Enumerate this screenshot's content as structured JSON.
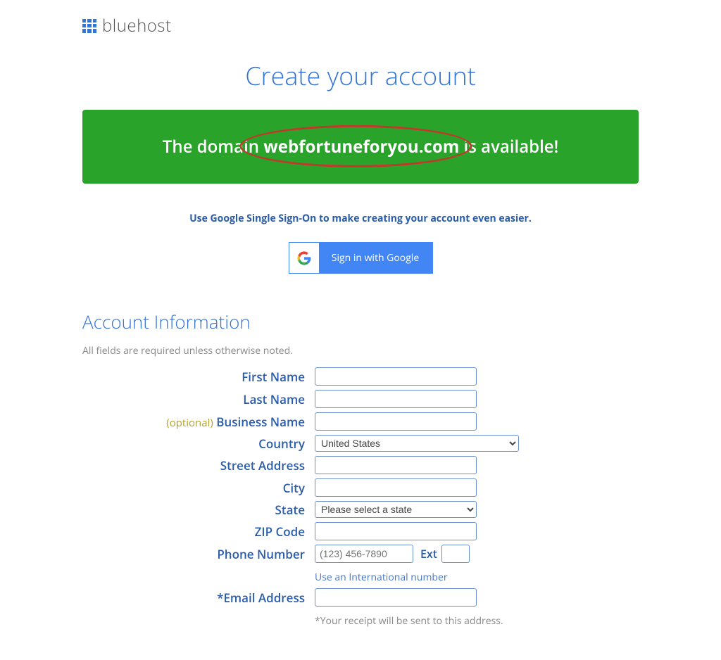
{
  "logo": {
    "text": "bluehost"
  },
  "page_title": "Create your account",
  "banner": {
    "prefix": "The domain ",
    "domain": "webfortuneforyou.com",
    "suffix": " is available!"
  },
  "sso": {
    "text": "Use Google Single Sign-On to make creating your account even easier.",
    "button_label": "Sign in with Google"
  },
  "section": {
    "title": "Account Information",
    "subtitle": "All fields are required unless otherwise noted."
  },
  "form": {
    "first_name": {
      "label": "First Name",
      "value": ""
    },
    "last_name": {
      "label": "Last Name",
      "value": ""
    },
    "business_name": {
      "optional": "(optional)",
      "label": "Business Name",
      "value": ""
    },
    "country": {
      "label": "Country",
      "selected": "United States"
    },
    "street": {
      "label": "Street Address",
      "value": ""
    },
    "city": {
      "label": "City",
      "value": ""
    },
    "state": {
      "label": "State",
      "selected": "Please select a state"
    },
    "zip": {
      "label": "ZIP Code",
      "value": ""
    },
    "phone": {
      "label": "Phone Number",
      "placeholder": "(123) 456-7890",
      "ext_label": "Ext",
      "intl_link": "Use an International number"
    },
    "email": {
      "label": "*Email Address",
      "value": "",
      "note": "*Your receipt will be sent to this address."
    }
  }
}
